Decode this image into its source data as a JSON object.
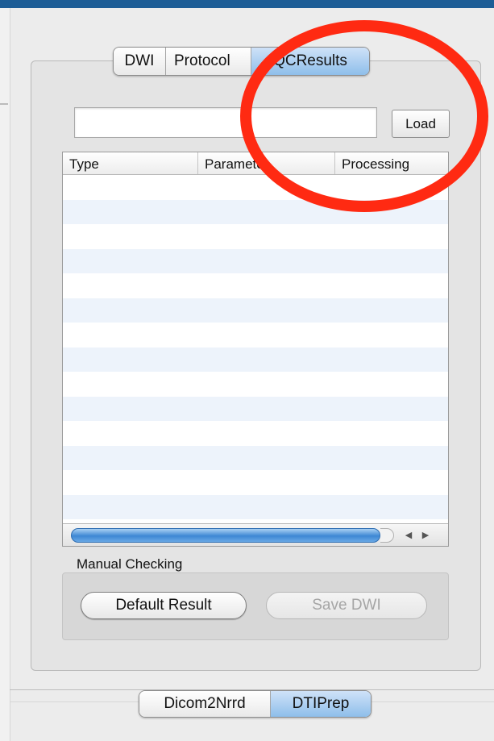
{
  "tabs": {
    "items": [
      {
        "label": "DWI"
      },
      {
        "label": "Protocol"
      },
      {
        "label": "QCResults"
      }
    ],
    "active": "QCResults"
  },
  "load": {
    "label": "Load",
    "path_value": ""
  },
  "table": {
    "columns": [
      {
        "label": "Type"
      },
      {
        "label": "Parameter"
      },
      {
        "label": "Processing"
      }
    ],
    "row_count": 14,
    "scroll_fraction": 0.95
  },
  "manual_checking": {
    "label": "Manual Checking",
    "default_result_label": "Default Result",
    "save_dwi_label": "Save DWI"
  },
  "bottom_tabs": {
    "items": [
      {
        "label": "Dicom2Nrrd"
      },
      {
        "label": "DTIPrep"
      }
    ],
    "active": "DTIPrep"
  },
  "colors": {
    "annotation_ring": "#ff2a12",
    "title_bar": "#1d5d96",
    "active_tab": "#8ebeea"
  },
  "icons": [
    "scroll-left-arrow-icon",
    "scroll-right-arrow-icon"
  ]
}
